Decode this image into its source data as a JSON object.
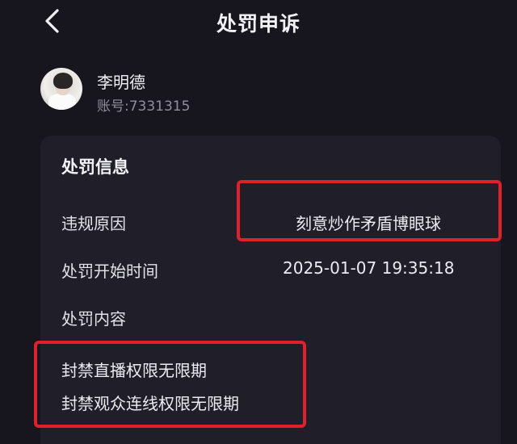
{
  "header": {
    "back_icon": "chevron-left-icon",
    "title": "处罚申诉"
  },
  "user": {
    "name": "李明德",
    "account": "账号:7331315"
  },
  "punishment": {
    "section_title": "处罚信息",
    "reason_label": "违规原因",
    "reason_value": "刻意炒作矛盾博眼球",
    "start_time_label": "处罚开始时间",
    "start_time_value": "2025-01-07 19:35:18",
    "content_label": "处罚内容",
    "content_items": [
      "封禁直播权限无限期",
      "封禁观众连线权限无限期"
    ]
  },
  "colors": {
    "background": "#17161f",
    "card": "#1f1e29",
    "highlight_border": "#e0202a"
  }
}
